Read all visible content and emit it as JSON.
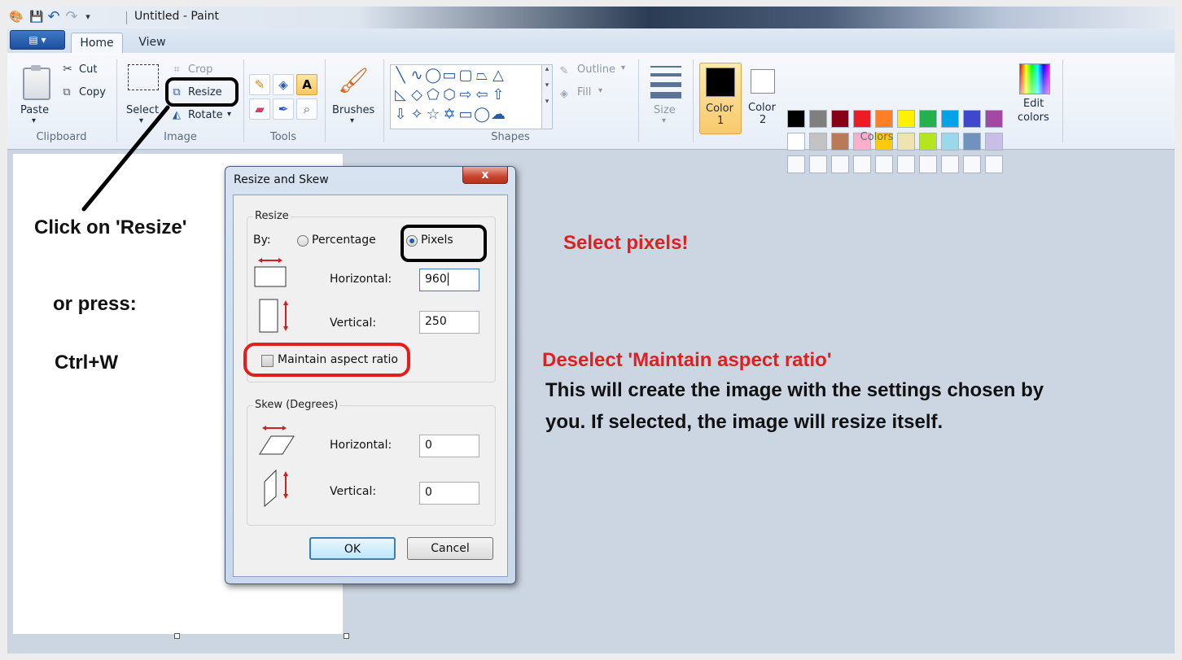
{
  "window": {
    "title": "Untitled - Paint"
  },
  "tabs": [
    {
      "label": "Home"
    },
    {
      "label": "View"
    }
  ],
  "ribbon": {
    "clipboard": {
      "paste": "Paste",
      "cut": "Cut",
      "copy": "Copy",
      "group": "Clipboard"
    },
    "image": {
      "crop": "Crop",
      "resize": "Resize",
      "rotate": "Rotate",
      "select": "Select",
      "group": "Image"
    },
    "tools": {
      "group": "Tools"
    },
    "brushes": {
      "label": "Brushes"
    },
    "shapes": {
      "outline": "Outline",
      "fill": "Fill",
      "group": "Shapes"
    },
    "size": {
      "label": "Size"
    },
    "colors": {
      "color1_line1": "Color",
      "color1_line2": "1",
      "color2_line1": "Color",
      "color2_line2": "2",
      "edit_line1": "Edit",
      "edit_line2": "colors",
      "group": "Colors",
      "color1_value": "#000000",
      "color2_value": "#ffffff",
      "palette_row1": [
        "#000000",
        "#7f7f7f",
        "#880015",
        "#ed1c24",
        "#ff7f27",
        "#fff200",
        "#22b14c",
        "#00a2e8",
        "#3f48cc",
        "#a349a4"
      ],
      "palette_row2": [
        "#ffffff",
        "#c3c3c3",
        "#b97a57",
        "#ffaec9",
        "#ffc90e",
        "#efe4b0",
        "#b5e61d",
        "#99d9ea",
        "#7092be",
        "#c8bfe7"
      ]
    }
  },
  "annotations": {
    "click_resize": "Click on 'Resize'",
    "or_press": "or press:",
    "shortcut": "Ctrl+W",
    "select_pixels": "Select pixels!",
    "deselect": "Deselect 'Maintain aspect ratio'",
    "explain_line1": "This will create the image with the settings chosen by",
    "explain_line2": "you. If selected, the image will resize itself."
  },
  "dialog": {
    "title": "Resize and Skew",
    "close": "x",
    "resize_group": "Resize",
    "by": "By:",
    "percentage": "Percentage",
    "pixels": "Pixels",
    "horizontal": "Horizontal:",
    "vertical": "Vertical:",
    "resize_horizontal_value": "960",
    "resize_vertical_value": "250",
    "maintain_aspect": "Maintain aspect ratio",
    "skew_group": "Skew (Degrees)",
    "skew_horizontal_value": "0",
    "skew_vertical_value": "0",
    "ok": "OK",
    "cancel": "Cancel"
  }
}
